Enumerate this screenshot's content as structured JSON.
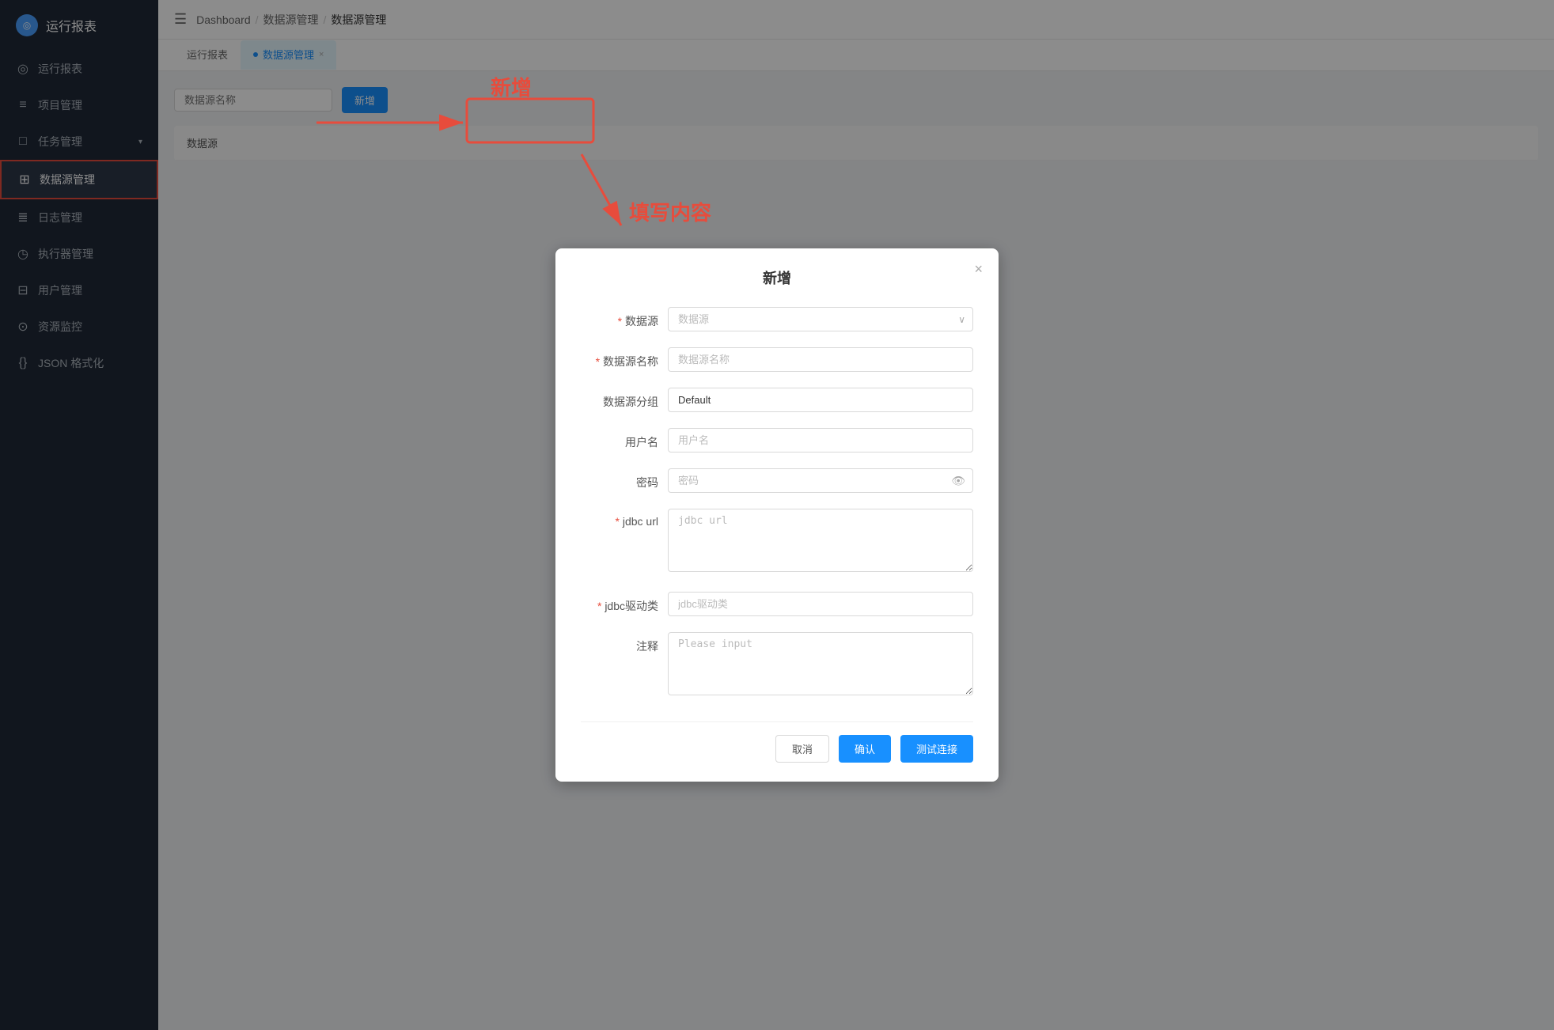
{
  "sidebar": {
    "logo": {
      "icon": "◉",
      "text": "运行报表"
    },
    "items": [
      {
        "id": "yunxing",
        "icon": "◎",
        "label": "运行报表",
        "active": false,
        "hasChevron": false
      },
      {
        "id": "xiangmu",
        "icon": "≡",
        "label": "项目管理",
        "active": false,
        "hasChevron": false
      },
      {
        "id": "renwu",
        "icon": "□",
        "label": "任务管理",
        "active": false,
        "hasChevron": true
      },
      {
        "id": "shujuyuan",
        "icon": "⊞",
        "label": "数据源管理",
        "active": true,
        "hasChevron": false
      },
      {
        "id": "rizhi",
        "icon": "≣",
        "label": "日志管理",
        "active": false,
        "hasChevron": false
      },
      {
        "id": "zhixingqi",
        "icon": "◷",
        "label": "执行器管理",
        "active": false,
        "hasChevron": false
      },
      {
        "id": "yonghu",
        "icon": "⊟",
        "label": "用户管理",
        "active": false,
        "hasChevron": false
      },
      {
        "id": "ziyuan",
        "icon": "⊙",
        "label": "资源监控",
        "active": false,
        "hasChevron": false
      },
      {
        "id": "json",
        "icon": "{}",
        "label": "JSON 格式化",
        "active": false,
        "hasChevron": false
      }
    ]
  },
  "topbar": {
    "breadcrumb": {
      "items": [
        "Dashboard",
        "数据源管理",
        "数据源管理"
      ],
      "separators": [
        "/",
        "/"
      ]
    }
  },
  "tabs": [
    {
      "id": "yunxing",
      "label": "运行报表",
      "active": false,
      "closable": false
    },
    {
      "id": "shujuyuan",
      "label": "数据源管理",
      "active": true,
      "closable": true
    }
  ],
  "table": {
    "search_placeholder": "数据源名称",
    "add_button": "新增",
    "columns": [
      "数据源"
    ]
  },
  "dialog": {
    "title": "新增",
    "close_label": "×",
    "fields": {
      "datasource": {
        "label": "数据源",
        "required": true,
        "placeholder": "数据源",
        "type": "select"
      },
      "datasource_name": {
        "label": "数据源名称",
        "required": true,
        "placeholder": "数据源名称",
        "type": "input"
      },
      "datasource_group": {
        "label": "数据源分组",
        "required": false,
        "value": "Default",
        "type": "input"
      },
      "username": {
        "label": "用户名",
        "required": false,
        "placeholder": "用户名",
        "type": "input"
      },
      "password": {
        "label": "密码",
        "required": false,
        "placeholder": "密码",
        "type": "password"
      },
      "jdbc_url": {
        "label": "jdbc url",
        "required": true,
        "placeholder": "jdbc url",
        "type": "textarea"
      },
      "jdbc_driver": {
        "label": "jdbc驱动类",
        "required": true,
        "placeholder": "jdbc驱动类",
        "type": "input"
      },
      "notes": {
        "label": "注释",
        "required": false,
        "placeholder": "Please input",
        "type": "textarea"
      }
    },
    "footer": {
      "cancel_label": "取消",
      "confirm_label": "确认",
      "test_label": "测试连接"
    }
  },
  "annotations": {
    "xin_zeng": "新增",
    "tian_xie": "填写内容"
  }
}
